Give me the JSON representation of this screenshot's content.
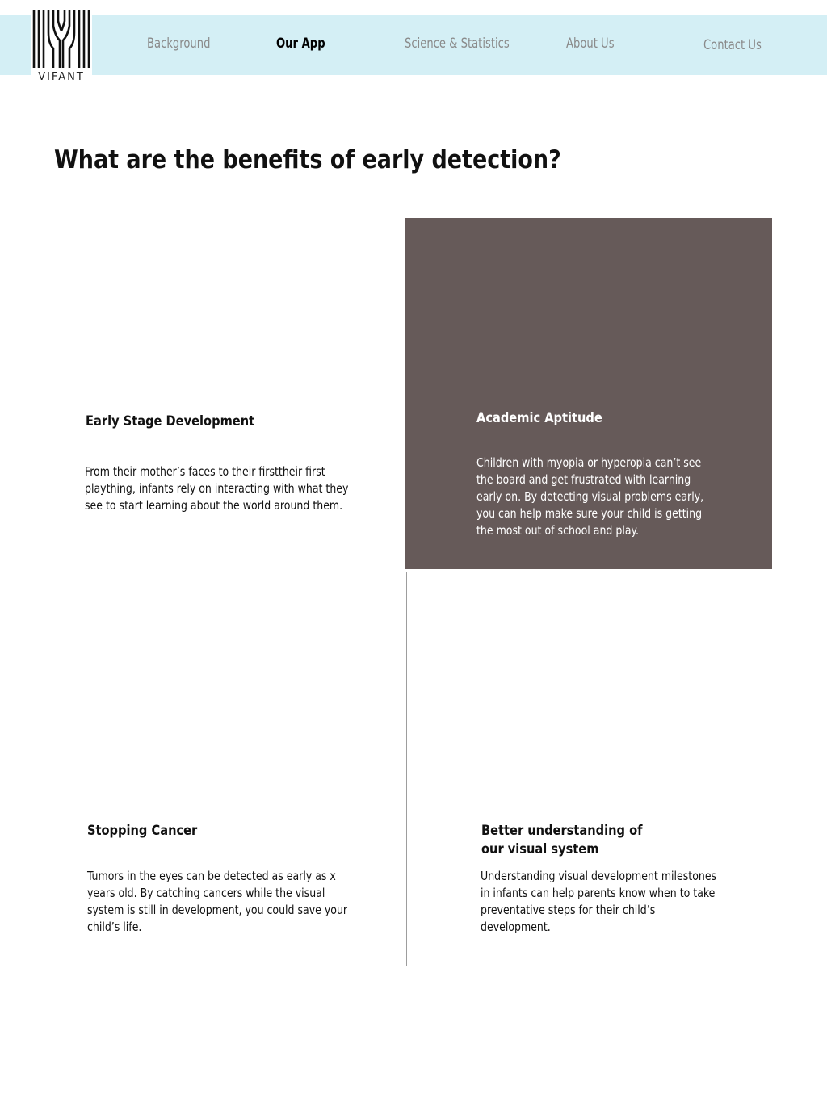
{
  "brand": {
    "name": "VIFANT"
  },
  "nav": {
    "items": [
      {
        "label": "Background",
        "active": false
      },
      {
        "label": "Our App",
        "active": true
      },
      {
        "label": "Science & Statistics",
        "active": false
      },
      {
        "label": "About Us",
        "active": false
      },
      {
        "label": "Contact Us",
        "active": false
      }
    ]
  },
  "page": {
    "title": "What are the benefits of early detection?"
  },
  "cards": [
    {
      "heading": "Early Stage Development",
      "body": "From their mother’s faces to their firsttheir first plaything, infants rely on interacting with what they see to start learning about the world around them."
    },
    {
      "heading": "Academic Aptitude",
      "body": "Children with myopia or hyperopia can’t see the board and get frustrated with learning early on. By detecting visual problems early, you can help make sure your child is getting the most out of school and play."
    },
    {
      "heading": "Stopping Cancer",
      "body": "Tumors in the eyes can be detected as early as x years old. By catching cancers while the visual system is still in development, you could save your child’s life."
    },
    {
      "heading": "Better understanding of our visual system",
      "body": "Understanding visual development milestones in infants can help parents know when to take preventative steps for their child’s development."
    }
  ],
  "colors": {
    "nav_background": "#d4eff5",
    "panel_background": "#665a59",
    "nav_inactive": "#8a8a8a"
  }
}
